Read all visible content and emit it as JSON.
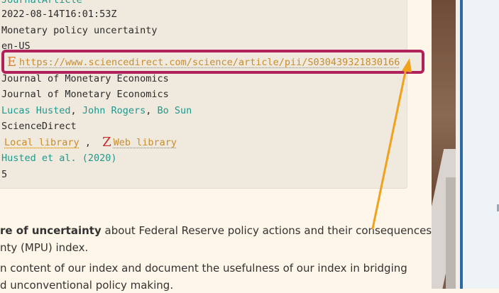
{
  "metadata": {
    "item_type": "JournalArticle",
    "date_modified": "2022-08-14T16:01:53Z",
    "title": "Monetary policy uncertainty",
    "language": "en-US",
    "url": "https://www.sciencedirect.com/science/article/pii/S030439321830166",
    "publication": "Journal of Monetary Economics",
    "journal_abbr": "Journal of Monetary Economics",
    "authors": [
      "Lucas Husted",
      "John Rogers",
      "Bo Sun"
    ],
    "author_separator": ",",
    "library_catalog": "ScienceDirect",
    "library_links": {
      "local": "Local library",
      "separator": ",",
      "web": "Web library",
      "icon_letter": "Z"
    },
    "citation": "Husted et al. (2020)",
    "count": "5",
    "url_icon_letter": "E"
  },
  "body": {
    "line1_bold": "re of uncertainty",
    "line1_rest": " about Federal Reserve policy actions and their consequences,",
    "line2": "nty (MPU) index.",
    "line3": "n content of our index and document the usefulness of our index in bridging",
    "line4": "d unconventional policy making."
  },
  "colors": {
    "highlight_border": "#b2225a",
    "teal_link": "#20988d",
    "gold_link": "#c88d2e",
    "arrow": "#f0a21c"
  }
}
